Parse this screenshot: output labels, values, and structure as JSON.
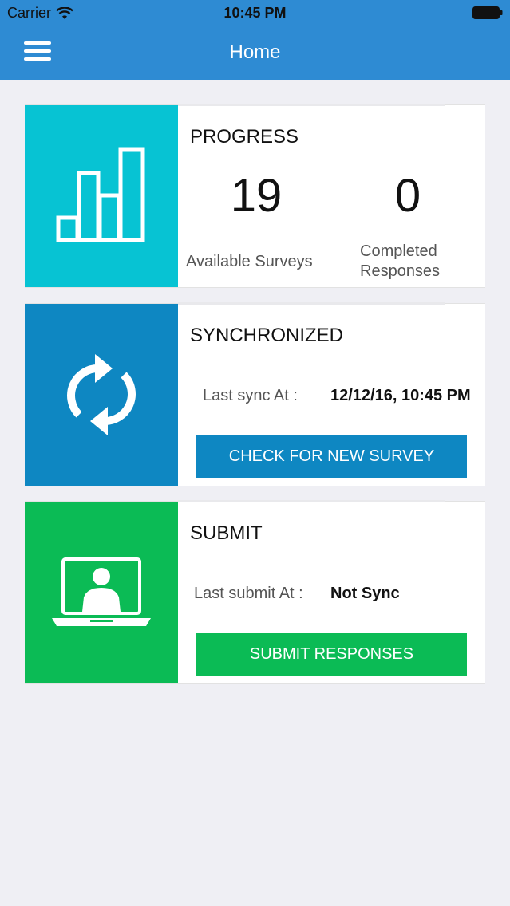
{
  "status_bar": {
    "carrier": "Carrier",
    "time": "10:45 PM"
  },
  "navbar": {
    "title": "Home"
  },
  "colors": {
    "header": "#2e8bd3",
    "progress_tile": "#07c3d3",
    "sync_tile": "#0e87c2",
    "submit_tile": "#0bbb55"
  },
  "progress": {
    "title": "PROGRESS",
    "icon": "bar-chart-icon",
    "available_count": "19",
    "available_label": "Available Surveys",
    "completed_count": "0",
    "completed_label": "Completed Responses"
  },
  "sync": {
    "title": "SYNCHRONIZED",
    "icon": "sync-icon",
    "last_sync_label": "Last sync At :",
    "last_sync_value": "12/12/16, 10:45 PM",
    "button_label": "CHECK FOR NEW SURVEY"
  },
  "submit": {
    "title": "SUBMIT",
    "icon": "laptop-user-icon",
    "last_submit_label": "Last submit At :",
    "last_submit_value": "Not Sync",
    "button_label": "SUBMIT RESPONSES"
  }
}
